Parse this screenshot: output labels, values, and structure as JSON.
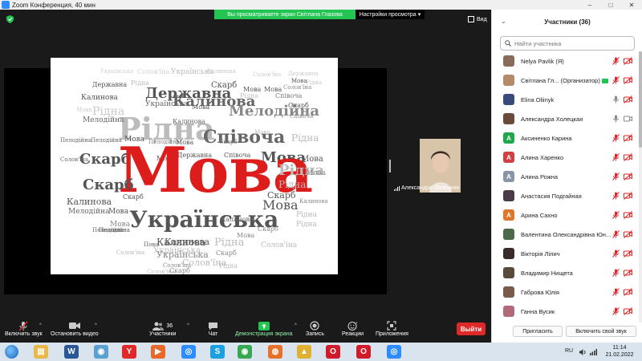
{
  "window": {
    "title": "Zoom Конференция, 40 мин",
    "controls": [
      "–",
      "□",
      "✕"
    ]
  },
  "banner": {
    "sharing_text": "Вы просматриваете экран Світлана Глазова",
    "view_options": "Настройки просмотра",
    "view_options_caret": "▾"
  },
  "view_button": {
    "label": "Вид"
  },
  "share": {
    "words": [
      {
        "t": "Українська",
        "c": "#d0d0d0"
      },
      {
        "t": "Солов'їна",
        "c": "#cfcfcf"
      },
      {
        "t": "Українська",
        "c": "#bbbbbb"
      },
      {
        "t": "Калинова",
        "c": "#c8c8c8"
      },
      {
        "t": "Солов'їна",
        "c": "#cccccc"
      },
      {
        "t": "Державна",
        "c": "#cccccc"
      },
      {
        "t": "Рідна",
        "c": "#c9c9c9"
      },
      {
        "t": "Мова",
        "c": "#555555"
      },
      {
        "t": "Державна",
        "c": "#555555"
      },
      {
        "t": "Рідна",
        "c": "#bbbbbb"
      },
      {
        "t": "Державна",
        "c": "#555555"
      },
      {
        "t": "Скарб",
        "c": "#555555"
      },
      {
        "t": "Мова",
        "c": "#555555"
      },
      {
        "t": "Мова",
        "c": "#555555"
      },
      {
        "t": "Солов'їна",
        "c": "#888888"
      },
      {
        "t": "Калинова",
        "c": "#555555"
      },
      {
        "t": "Українська",
        "c": "#666666"
      },
      {
        "t": "Рідна",
        "c": "#c0c0c0"
      },
      {
        "t": "Калинова",
        "c": "#666666"
      },
      {
        "t": "Мова",
        "c": "#555555"
      },
      {
        "t": "Співоча",
        "c": "#777777"
      },
      {
        "t": "Мова",
        "c": "#cccccc"
      },
      {
        "t": "Рідна",
        "c": "#c9c9c9"
      },
      {
        "t": "Мелодійна",
        "c": "#888888"
      },
      {
        "t": "Скарб",
        "c": "#555555"
      },
      {
        "t": "Рідна",
        "c": "#bcbcbc"
      },
      {
        "t": "Мелодійна",
        "c": "#666666"
      },
      {
        "t": "Калинова",
        "c": "#666666"
      },
      {
        "t": "Співоча",
        "c": "#666666"
      },
      {
        "t": "Рідна",
        "c": "#bbbbbb"
      },
      {
        "t": "Мова",
        "c": "#bbbbbb"
      },
      {
        "t": "Співоча",
        "c": "#888888"
      },
      {
        "t": "Пелодійна",
        "c": "#666666"
      },
      {
        "t": "Пелодійна",
        "c": "#666666"
      },
      {
        "t": "Мова",
        "c": "#555555"
      },
      {
        "t": "Пелодійна",
        "c": "#888888"
      },
      {
        "t": "Мова",
        "c": "#555555"
      },
      {
        "t": "Скарб",
        "c": "#777777"
      },
      {
        "t": "Скарб",
        "c": "#555555"
      },
      {
        "t": "Державна",
        "c": "#555555"
      },
      {
        "t": "Співоча",
        "c": "#555555"
      },
      {
        "t": "Мова",
        "c": "#555555"
      },
      {
        "t": "Мова",
        "c": "#555555"
      },
      {
        "t": "Мова",
        "c": "#555555"
      },
      {
        "t": "Солов'їна",
        "c": "#666666"
      },
      {
        "t": "Мова",
        "c": "#dd1c1c"
      },
      {
        "t": "Рідна",
        "c": "#bbbbbb"
      },
      {
        "t": "Мова",
        "c": "#888888"
      },
      {
        "t": "Скарб",
        "c": "#555555"
      },
      {
        "t": "Рідна",
        "c": "#bbbbbb"
      },
      {
        "t": "Скарб",
        "c": "#555555"
      },
      {
        "t": "Калинова",
        "c": "#555555"
      },
      {
        "t": "Мелодійна",
        "c": "#666666"
      },
      {
        "t": "Мова",
        "c": "#555555"
      },
      {
        "t": "Скарб",
        "c": "#555555"
      },
      {
        "t": "Мова",
        "c": "#555555"
      },
      {
        "t": "Калинова",
        "c": "#888888"
      },
      {
        "t": "Мова",
        "c": "#888888"
      },
      {
        "t": "Українська",
        "c": "#555555"
      },
      {
        "t": "Калинова",
        "c": "#666666"
      },
      {
        "t": "Рідна",
        "c": "#bbbbbb"
      },
      {
        "t": "Пелодійна",
        "c": "#666666"
      },
      {
        "t": "Пелодійна",
        "c": "#555555"
      },
      {
        "t": "Рідна",
        "c": "#bbbbbb"
      },
      {
        "t": "Калинова",
        "c": "#555555"
      },
      {
        "t": "Українська",
        "c": "#bbbbbb"
      },
      {
        "t": "Пово",
        "c": "#666666"
      },
      {
        "t": "Калинова",
        "c": "#555555"
      },
      {
        "t": "Рідна",
        "c": "#bbbbbb"
      },
      {
        "t": "Мова",
        "c": "#888888"
      },
      {
        "t": "Скарб",
        "c": "#888888"
      },
      {
        "t": "Солов'їна",
        "c": "#bbbbbb"
      },
      {
        "t": "Українська",
        "c": "#888888"
      },
      {
        "t": "Солов'їна",
        "c": "#888888"
      },
      {
        "t": "Солов'їна",
        "c": "#bbbbbb"
      },
      {
        "t": "Скарб",
        "c": "#888888"
      },
      {
        "t": "Скарб",
        "c": "#888888"
      },
      {
        "t": "Солов'їна",
        "c": "#bbbbbb"
      },
      {
        "t": "Рідна",
        "c": "#bbbbbb"
      },
      {
        "t": "Солов'їна",
        "c": "#bbbbbb"
      }
    ]
  },
  "video_tile": {
    "name": "Александра Холецкая"
  },
  "toolbar": {
    "mute": "Включить звук",
    "stop_video": "Остановить видео",
    "participants": "Участники",
    "participants_count": "36",
    "chat": "Чат",
    "share_screen": "Демонстрация экрана",
    "record": "Запись",
    "reactions": "Реакции",
    "apps": "Приложения",
    "leave": "Выйти",
    "caret": "^"
  },
  "panel": {
    "title": "Участники (36)",
    "chevron": "⌄",
    "search_placeholder": "Найти участника",
    "participants": [
      {
        "name": "Nelya Pavlik (Я)",
        "color": "#8a6b5a",
        "letter": "",
        "mic": "muted",
        "cam": "off"
      },
      {
        "name": "Світлана Гл... (Организатор)",
        "color": "#b58a6a",
        "letter": "",
        "mic": "muted",
        "cam": "off",
        "host": true
      },
      {
        "name": "Elina Oliinyk",
        "color": "#3a4a7a",
        "letter": "",
        "mic": "off",
        "cam": "off"
      },
      {
        "name": "Александра Холецкая",
        "color": "#6a4a3a",
        "letter": "",
        "mic": "on",
        "cam": "on"
      },
      {
        "name": "Аксиненко Карина",
        "color": "#1ea84a",
        "letter": "А",
        "mic": "muted",
        "cam": "off"
      },
      {
        "name": "Алина Харенко",
        "color": "#d13f3f",
        "letter": "А",
        "mic": "muted",
        "cam": "off"
      },
      {
        "name": "Алина Рожна",
        "color": "#8a96a6",
        "letter": "А",
        "mic": "muted",
        "cam": "off"
      },
      {
        "name": "Анастасия Подгайная",
        "color": "#4a3a4a",
        "letter": "",
        "mic": "muted",
        "cam": "off"
      },
      {
        "name": "Арина Сахно",
        "color": "#e0762a",
        "letter": "А",
        "mic": "muted",
        "cam": "off"
      },
      {
        "name": "Валентина Олександрівна Юн...",
        "color": "#4a6a4a",
        "letter": "",
        "mic": "muted",
        "cam": "off"
      },
      {
        "name": "Вікторія Лілич",
        "color": "#3a2a2a",
        "letter": "",
        "mic": "muted",
        "cam": "off"
      },
      {
        "name": "Владимир Нищета",
        "color": "#5a4a3a",
        "letter": "",
        "mic": "muted",
        "cam": "off"
      },
      {
        "name": "Габрова Юлія",
        "color": "#7a5a4a",
        "letter": "",
        "mic": "muted",
        "cam": "off"
      },
      {
        "name": "Ганна Вусик",
        "color": "#b06a7a",
        "letter": "",
        "mic": "muted",
        "cam": "off"
      }
    ],
    "invite": "Пригласить",
    "unmute_me": "Включить свой звук"
  },
  "taskbar": {
    "lang": "RU",
    "time": "11:14",
    "date": "21.02.2022",
    "apps": [
      {
        "id": "explorer",
        "glyph": "▤",
        "color": "#e8b949"
      },
      {
        "id": "word",
        "glyph": "W",
        "color": "#2b5797"
      },
      {
        "id": "network",
        "glyph": "◉",
        "color": "#5aa0d0"
      },
      {
        "id": "yandex",
        "glyph": "Y",
        "color": "#e02828"
      },
      {
        "id": "media",
        "glyph": "▶",
        "color": "#e86a2a"
      },
      {
        "id": "zoom",
        "glyph": "◎",
        "color": "#2d8cff"
      },
      {
        "id": "skype",
        "glyph": "S",
        "color": "#1a9fe0"
      },
      {
        "id": "chrome",
        "glyph": "◉",
        "color": "#36a852"
      },
      {
        "id": "firefox",
        "glyph": "◍",
        "color": "#e8702a"
      },
      {
        "id": "alert",
        "glyph": "▲",
        "color": "#e0b030"
      },
      {
        "id": "opera",
        "glyph": "O",
        "color": "#d01c2a"
      },
      {
        "id": "opera2",
        "glyph": "O",
        "color": "#d01c2a"
      },
      {
        "id": "zoom2",
        "glyph": "◎",
        "color": "#2d8cff"
      }
    ]
  }
}
